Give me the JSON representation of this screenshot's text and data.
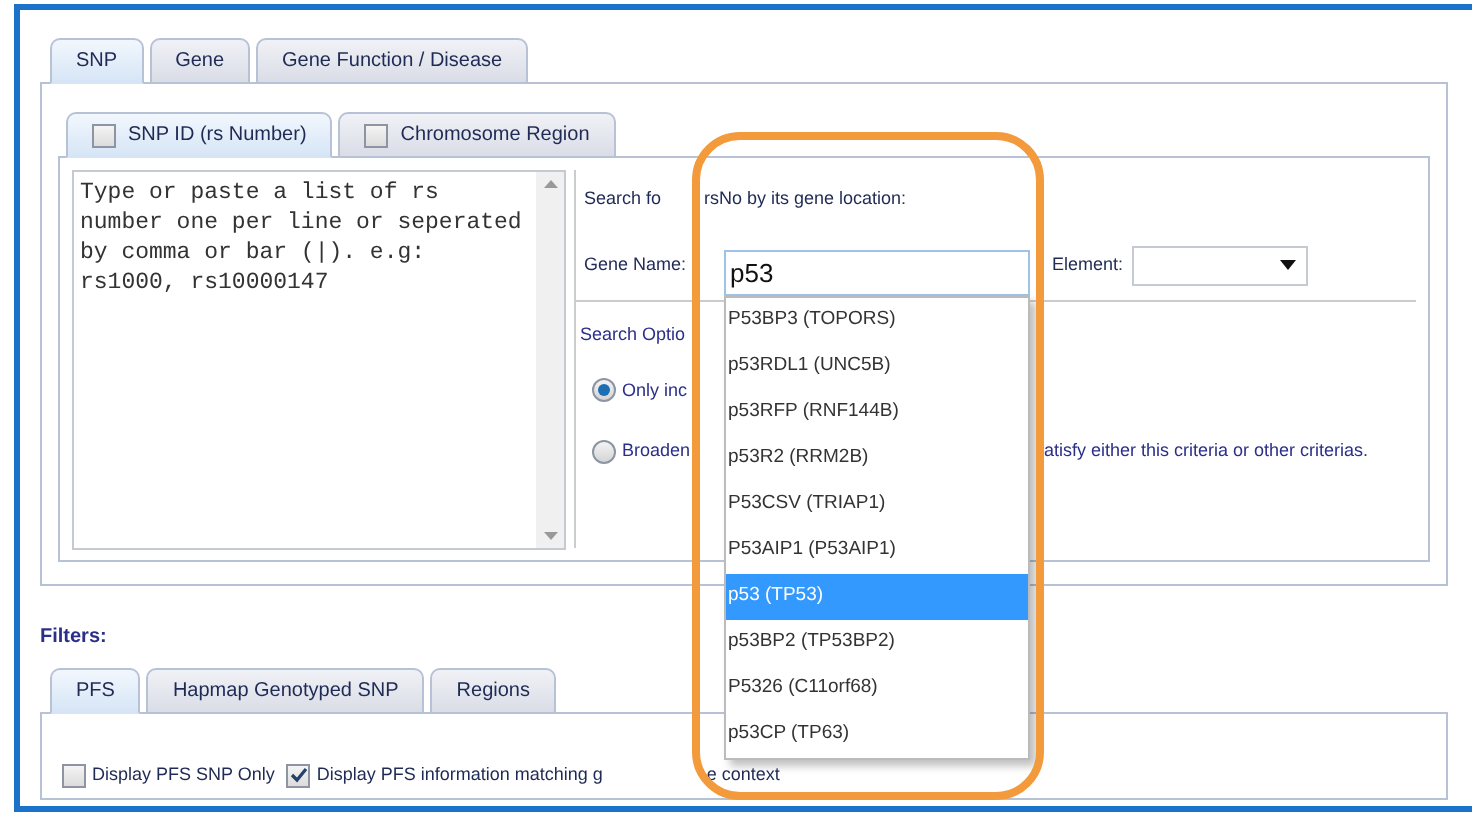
{
  "main_tabs": [
    {
      "label": "SNP",
      "selected": true
    },
    {
      "label": "Gene",
      "selected": false
    },
    {
      "label": "Gene Function / Disease",
      "selected": false
    }
  ],
  "sub_tabs": [
    {
      "label": "SNP ID (rs Number)",
      "selected": true,
      "checked": false
    },
    {
      "label": "Chromosome Region",
      "selected": false,
      "checked": false
    }
  ],
  "rs_input": {
    "placeholder": "Type or paste a list of rs number one per line or seperated by comma or bar (|). e.g: rs1000, rs10000147"
  },
  "gene_search": {
    "heading": "Search fo",
    "heading_tail": "rsNo by its gene location:",
    "gene_label": "Gene Name:",
    "gene_value": "p53",
    "element_label": "Element:"
  },
  "search_options": {
    "heading": "Search Optio",
    "options": [
      {
        "label": "Only inc",
        "selected": true
      },
      {
        "label": "Broaden",
        "selected": false,
        "tail": "atisfy either this criteria or other criterias."
      }
    ]
  },
  "suggestions": [
    {
      "label": "P53BP3 (TOPORS)",
      "selected": false
    },
    {
      "label": "p53RDL1 (UNC5B)",
      "selected": false
    },
    {
      "label": "p53RFP (RNF144B)",
      "selected": false
    },
    {
      "label": "p53R2 (RRM2B)",
      "selected": false
    },
    {
      "label": "P53CSV (TRIAP1)",
      "selected": false
    },
    {
      "label": "P53AIP1 (P53AIP1)",
      "selected": false
    },
    {
      "label": "p53 (TP53)",
      "selected": true
    },
    {
      "label": "p53BP2 (TP53BP2)",
      "selected": false
    },
    {
      "label": "P5326 (C11orf68)",
      "selected": false
    },
    {
      "label": "p53CP (TP63)",
      "selected": false
    }
  ],
  "filters": {
    "heading": "Filters:",
    "tabs": [
      {
        "label": "PFS",
        "selected": true
      },
      {
        "label": "Hapmap Genotyped SNP",
        "selected": false
      },
      {
        "label": "Regions",
        "selected": false
      }
    ],
    "options": [
      {
        "label": "Display PFS SNP Only",
        "checked": false
      },
      {
        "label": "Display PFS information matching g",
        "checked": true,
        "tail": "e context"
      }
    ]
  }
}
